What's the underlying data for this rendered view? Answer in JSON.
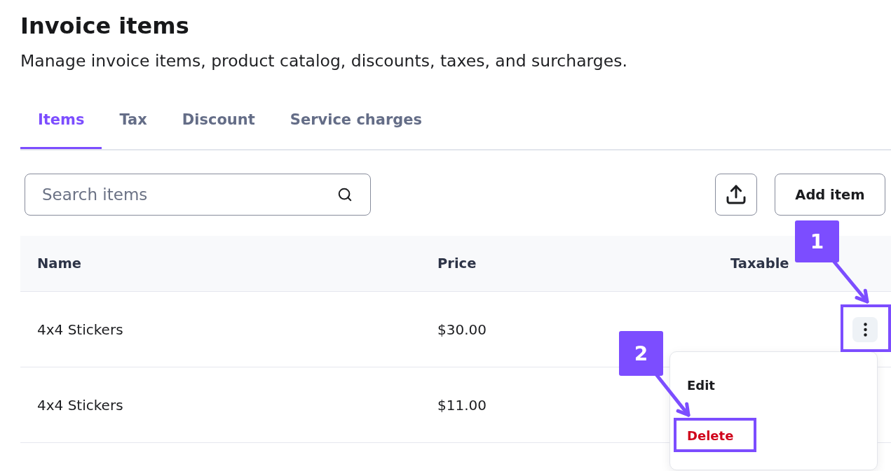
{
  "header": {
    "title": "Invoice items",
    "subtitle": "Manage invoice items, product catalog, discounts, taxes, and surcharges."
  },
  "tabs": [
    {
      "label": "Items",
      "selected": true
    },
    {
      "label": "Tax",
      "selected": false
    },
    {
      "label": "Discount",
      "selected": false
    },
    {
      "label": "Service charges",
      "selected": false
    }
  ],
  "toolbar": {
    "search": {
      "placeholder": "Search items"
    },
    "add_button": "Add item"
  },
  "table": {
    "columns": [
      "Name",
      "Price",
      "Taxable"
    ],
    "rows": [
      {
        "name": "4x4 Stickers",
        "price": "$30.00",
        "actions": {
          "open": true,
          "menu": [
            {
              "label": "Edit",
              "kind": "normal"
            },
            {
              "label": "Delete",
              "kind": "danger"
            }
          ]
        }
      },
      {
        "name": "4x4 Stickers",
        "price": "$11.00"
      }
    ]
  },
  "callouts": [
    {
      "number": "1"
    },
    {
      "number": "2"
    }
  ]
}
